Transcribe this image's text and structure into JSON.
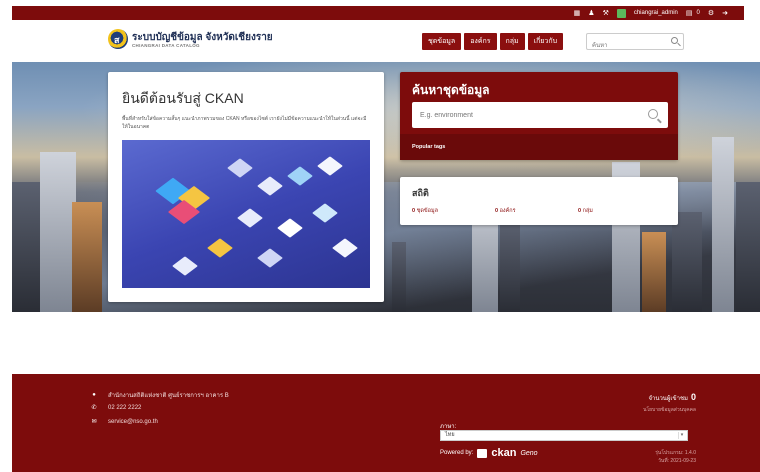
{
  "topbar": {
    "icons": [
      "dashboard-icon",
      "user-icon",
      "wrench-icon"
    ],
    "username": "chiangrai_admin",
    "dataset_count": "0",
    "settings_icon": "gear-icon",
    "logout_icon": "logout-icon"
  },
  "masthead": {
    "site_title": "ระบบบัญชีข้อมูล จังหวัดเชียงราย",
    "site_subtitle": "CHIANGRAI DATA CATALOG",
    "nav": [
      "ชุดข้อมูล",
      "องค์กร",
      "กลุ่ม",
      "เกี่ยวกับ"
    ],
    "search_placeholder": "ค้นหา"
  },
  "hero": {
    "welcome_title": "ยินดีต้อนรับสู่ CKAN",
    "welcome_text": "พื้นที่สำหรับใส่ข้อความสั้นๆ แนะนำภาพรวมของ CKAN หรือของไซต์ เรายังไม่มีข้อความแนะนำให้ในส่วนนี้ แต่จะมีให้ในอนาคต",
    "search_title": "ค้นหาชุดข้อมูล",
    "search_placeholder": "E.g. environment",
    "popular_tags": "Popular tags",
    "stats_title": "สถิติ",
    "stats": [
      {
        "count": "0",
        "label": "ชุดข้อมูล"
      },
      {
        "count": "0",
        "label": "องค์กร"
      },
      {
        "count": "0",
        "label": "กลุ่ม"
      }
    ]
  },
  "footer": {
    "address": "สำนักงานสถิติแห่งชาติ ศูนย์ราชการฯ อาคาร B",
    "phone": "02 222 2222",
    "email": "service@nso.go.th",
    "visitors_label": "จำนวนผู้เข้าชม",
    "visitors_count": "0",
    "privacy": "นโยบายข้อมูลส่วนบุคคล",
    "language_label": "ภาษา:",
    "language_value": "ไทย",
    "powered_by": "Powered by:",
    "ckan": "ckan",
    "geno": "Geno",
    "version": "รุ่นโปรแกรม: 1.4.0",
    "version_date": "วันที่: 2021-09-23"
  },
  "colors": {
    "brand": "#7d0c0c",
    "brand_dark": "#6a0a0a",
    "nav_button": "#8b0f0f"
  }
}
